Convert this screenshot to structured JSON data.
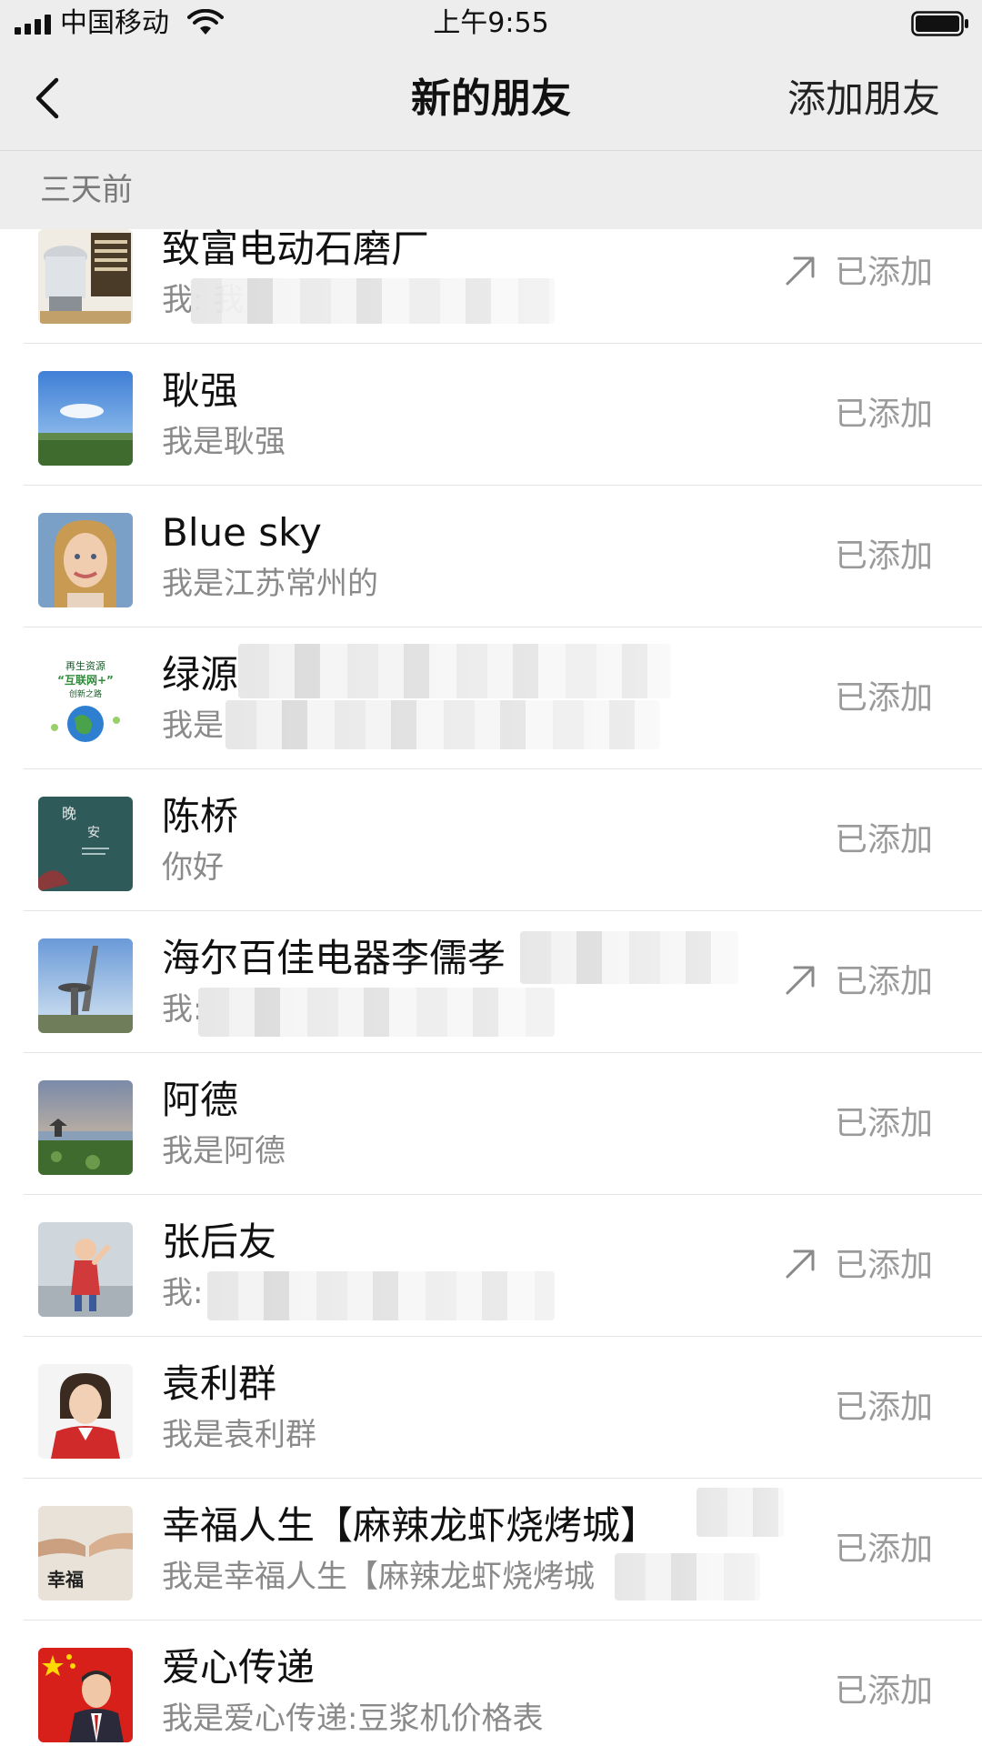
{
  "status_bar": {
    "carrier": "中国移动",
    "time": "上午9:55"
  },
  "nav": {
    "title": "新的朋友",
    "add_friend": "添加朋友"
  },
  "section": {
    "label": "三天前"
  },
  "friends": [
    {
      "name": "致富电动石磨厂",
      "message": "我: 我",
      "status": "已添加",
      "icon": "arrow-up-right-icon"
    },
    {
      "name": "耿强",
      "message": "我是耿强",
      "status": "已添加"
    },
    {
      "name": "Blue sky",
      "message": "我是江苏常州的",
      "status": "已添加"
    },
    {
      "name": "绿源",
      "message": "我是",
      "status": "已添加",
      "avatar_text": [
        "再生资源",
        "“互联网+”",
        "创新之路"
      ]
    },
    {
      "name": "陈桥",
      "message": "你好",
      "status": "已添加",
      "avatar_text": [
        "晚",
        "安"
      ]
    },
    {
      "name": "海尔百佳电器李儒孝",
      "message": "我:",
      "status": "已添加",
      "icon": "arrow-up-right-icon"
    },
    {
      "name": "阿德",
      "message": "我是阿德",
      "status": "已添加"
    },
    {
      "name": "张后友",
      "message": "我:",
      "status": "已添加",
      "icon": "arrow-up-right-icon"
    },
    {
      "name": "袁利群",
      "message": "我是袁利群",
      "status": "已添加"
    },
    {
      "name": "幸福人生【麻辣龙虾烧烤城】",
      "message": "我是幸福人生【麻辣龙虾烧烤城",
      "status": "已添加",
      "avatar_text": [
        "幸福"
      ]
    },
    {
      "name": "爱心传递",
      "message": "我是爱心传递:豆浆机价格表",
      "status": "已添加"
    }
  ]
}
